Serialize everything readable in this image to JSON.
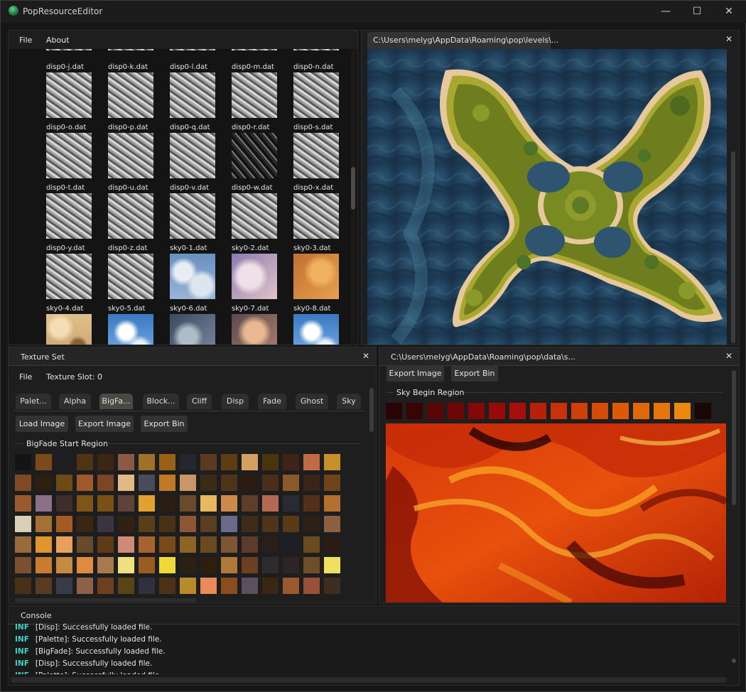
{
  "app": {
    "title": "PopResourceEditor"
  },
  "window_controls": {
    "minimize": "—",
    "maximize": "☐",
    "close": "✕"
  },
  "browser": {
    "menu": [
      "File",
      "About"
    ],
    "thumbs": [
      {
        "label": "disp0-j.dat",
        "kind": "disp"
      },
      {
        "label": "disp0-k.dat",
        "kind": "disp"
      },
      {
        "label": "disp0-l.dat",
        "kind": "disp"
      },
      {
        "label": "disp0-m.dat",
        "kind": "disp"
      },
      {
        "label": "disp0-n.dat",
        "kind": "disp"
      },
      {
        "label": "disp0-o.dat",
        "kind": "disp"
      },
      {
        "label": "disp0-p.dat",
        "kind": "disp"
      },
      {
        "label": "disp0-q.dat",
        "kind": "disp"
      },
      {
        "label": "disp0-r.dat",
        "kind": "dispdark"
      },
      {
        "label": "disp0-s.dat",
        "kind": "disp"
      },
      {
        "label": "disp0-t.dat",
        "kind": "disp"
      },
      {
        "label": "disp0-u.dat",
        "kind": "disp"
      },
      {
        "label": "disp0-v.dat",
        "kind": "disp"
      },
      {
        "label": "disp0-w.dat",
        "kind": "disp"
      },
      {
        "label": "disp0-x.dat",
        "kind": "disp"
      },
      {
        "label": "disp0-y.dat",
        "kind": "disp"
      },
      {
        "label": "disp0-z.dat",
        "kind": "disp"
      },
      {
        "label": "sky0-1.dat",
        "kind": "skyblue"
      },
      {
        "label": "sky0-2.dat",
        "kind": "skypurple"
      },
      {
        "label": "sky0-3.dat",
        "kind": "skyorange"
      },
      {
        "label": "sky0-4.dat",
        "kind": "skysand"
      },
      {
        "label": "sky0-5.dat",
        "kind": "skyclear"
      },
      {
        "label": "sky0-6.dat",
        "kind": "skystorm"
      },
      {
        "label": "sky0-7.dat",
        "kind": "skydusk"
      },
      {
        "label": "sky0-8.dat",
        "kind": "skyclear"
      },
      {
        "label": "",
        "kind": "skygrey"
      },
      {
        "label": "",
        "kind": "skydeep"
      },
      {
        "label": "",
        "kind": "skylight"
      },
      {
        "label": "",
        "kind": "skylight"
      },
      {
        "label": "",
        "kind": "skyisle"
      }
    ]
  },
  "level_view": {
    "tab_title": "C:\\Users\\melyg\\AppData\\Roaming\\pop\\levels\\..."
  },
  "texture_set": {
    "tab_title": "Texture Set",
    "menu": {
      "file": "File",
      "slot": "Texture Slot: 0"
    },
    "subtabs": [
      "Palet...",
      "Alpha",
      "BigFa...",
      "Block...",
      "Cliff",
      "Disp",
      "Fade",
      "Ghost",
      "Sky"
    ],
    "active_subtab": 2,
    "buttons": {
      "load": "Load Image",
      "export": "Export Image",
      "export_bin": "Export Bin"
    },
    "region_label": "BigFade Start Region",
    "swatches": [
      "#141414",
      "#7a4a1a",
      "#1e1e22",
      "#4e3414",
      "#3a2612",
      "#8a5a44",
      "#a0702a",
      "#9a6018",
      "#262630",
      "#5a3a20",
      "#5e3c14",
      "#d6a060",
      "#4a3410",
      "#3e2416",
      "#c26a44",
      "#c6902a",
      "#7e4a24",
      "#2e2010",
      "#6e4a16",
      "#9e5a2a",
      "#7a4624",
      "#e2b886",
      "#4a4a5a",
      "#c07a26",
      "#c89668",
      "#3a2a16",
      "#4e3418",
      "#2a1a12",
      "#4a2e1a",
      "#8a5a2a",
      "#3a2418",
      "#6e4418",
      "#9a5a30",
      "#8a7088",
      "#3e2e2a",
      "#7e5418",
      "#7a5016",
      "#5e4438",
      "#e0a22e",
      "#2a1e14",
      "#6a4a2a",
      "#e8b860",
      "#ce8a4a",
      "#5e3e2a",
      "#b46a52",
      "#2a2a34",
      "#542e18",
      "#b4702e",
      "#d8d0b4",
      "#a47036",
      "#a45a22",
      "#3a2612",
      "#3a3440",
      "#2e2214",
      "#5a3e1a",
      "#4a3014",
      "#8e5636",
      "#5a3e22",
      "#6a6a8a",
      "#3e2c18",
      "#4e3418",
      "#5a3a14",
      "#2e2018",
      "#8a6040",
      "#9a6a3a",
      "#e0962a",
      "#e8a05a",
      "#6a4a2e",
      "#5e3a16",
      "#d08a76",
      "#a8622e",
      "#7a4a1a",
      "#8e6424",
      "#6a4a20",
      "#7e5634",
      "#5e3a28",
      "#2a1e1a",
      "#1e1e26",
      "#6a4a1e",
      "#2a1c14",
      "#7a5032",
      "#c87c30",
      "#c88a42",
      "#e08a40",
      "#a87a4e",
      "#f0e080",
      "#9a5c22",
      "#f0d838",
      "#2a2014",
      "#2e1e0e",
      "#b07838",
      "#6e3e20",
      "#2e2a30",
      "#2e2428",
      "#6e4e28",
      "#f0e060",
      "#4a3018",
      "#5a3a20",
      "#3a3a4a",
      "#8e6048",
      "#6e4020",
      "#5a4416",
      "#32303e",
      "#4e3218",
      "#b88a2a",
      "#e88a5a",
      "#8a4e1e",
      "#5a5060",
      "#3a2612",
      "#9a5a30",
      "#985038",
      "#3e2e20"
    ]
  },
  "sky_view": {
    "tab_title": "C:\\Users\\melyg\\AppData\\Roaming\\pop\\data\\s...",
    "buttons": {
      "export": "Export Image",
      "export_bin": "Export Bin"
    },
    "region_label": "Sky Begin Region",
    "swatches": [
      "#2a0404",
      "#380404",
      "#5a0606",
      "#6e0606",
      "#840808",
      "#980a0a",
      "#a80e0a",
      "#b8200a",
      "#c8320a",
      "#d03e0a",
      "#d44c0a",
      "#da5a0a",
      "#e0680a",
      "#e6760c",
      "#ec880e",
      "#1a0606"
    ]
  },
  "console": {
    "tab_title": "Console",
    "lines": [
      {
        "level": "INF",
        "text": "[Disp]: Successfully loaded file."
      },
      {
        "level": "INF",
        "text": "[Palette]: Successfully loaded file."
      },
      {
        "level": "INF",
        "text": "[BigFade]: Successfully loaded file."
      },
      {
        "level": "INF",
        "text": "[Disp]: Successfully loaded file."
      },
      {
        "level": "INF",
        "text": "[Palette]: Successfully loaded file."
      }
    ]
  }
}
